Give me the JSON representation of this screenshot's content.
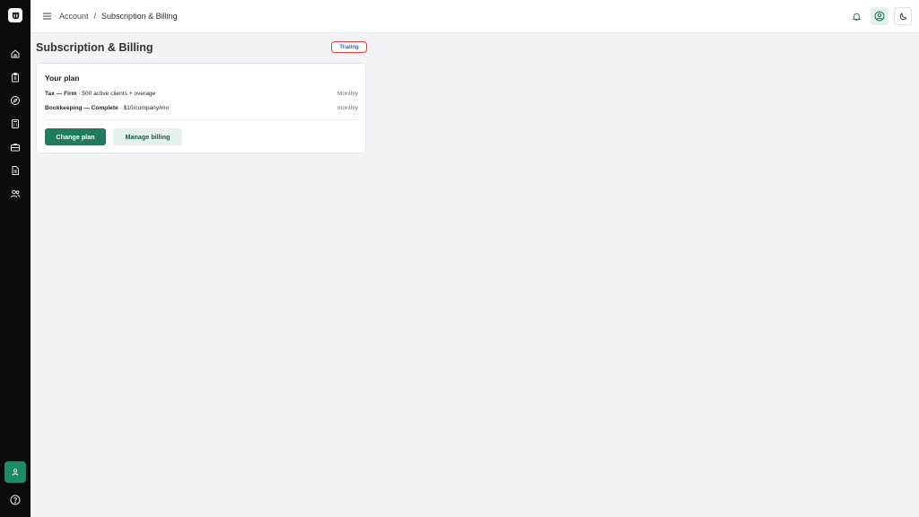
{
  "sidebar": {
    "logo_icon": "brand-logo",
    "items": [
      {
        "icon": "home-icon"
      },
      {
        "icon": "clipboard-icon"
      },
      {
        "icon": "compass-icon"
      },
      {
        "icon": "calculator-icon"
      },
      {
        "icon": "briefcase-icon"
      },
      {
        "icon": "document-icon"
      },
      {
        "icon": "users-icon"
      }
    ],
    "account_icon": "user-icon",
    "help_icon": "help-icon",
    "accent": "#1f8a67"
  },
  "topbar": {
    "breadcrumb": {
      "parent": "Account",
      "separator": "/",
      "current": "Subscription & Billing"
    }
  },
  "page": {
    "title": "Subscription & Billing",
    "status": "Trialing"
  },
  "plan_card": {
    "title": "Your plan",
    "rows": [
      {
        "name": "Tax — Firm",
        "detail": " · 500 active clients + overage",
        "period": "Monthly"
      },
      {
        "name": "Bookkeeping — Complete",
        "detail": " · $10/company/mo",
        "period": "monthly"
      }
    ],
    "change_plan_label": "Change plan",
    "manage_billing_label": "Manage billing"
  },
  "colors": {
    "primary": "#1f7d5e",
    "badge_border": "#d64545",
    "badge_text": "#3b5bb5"
  }
}
